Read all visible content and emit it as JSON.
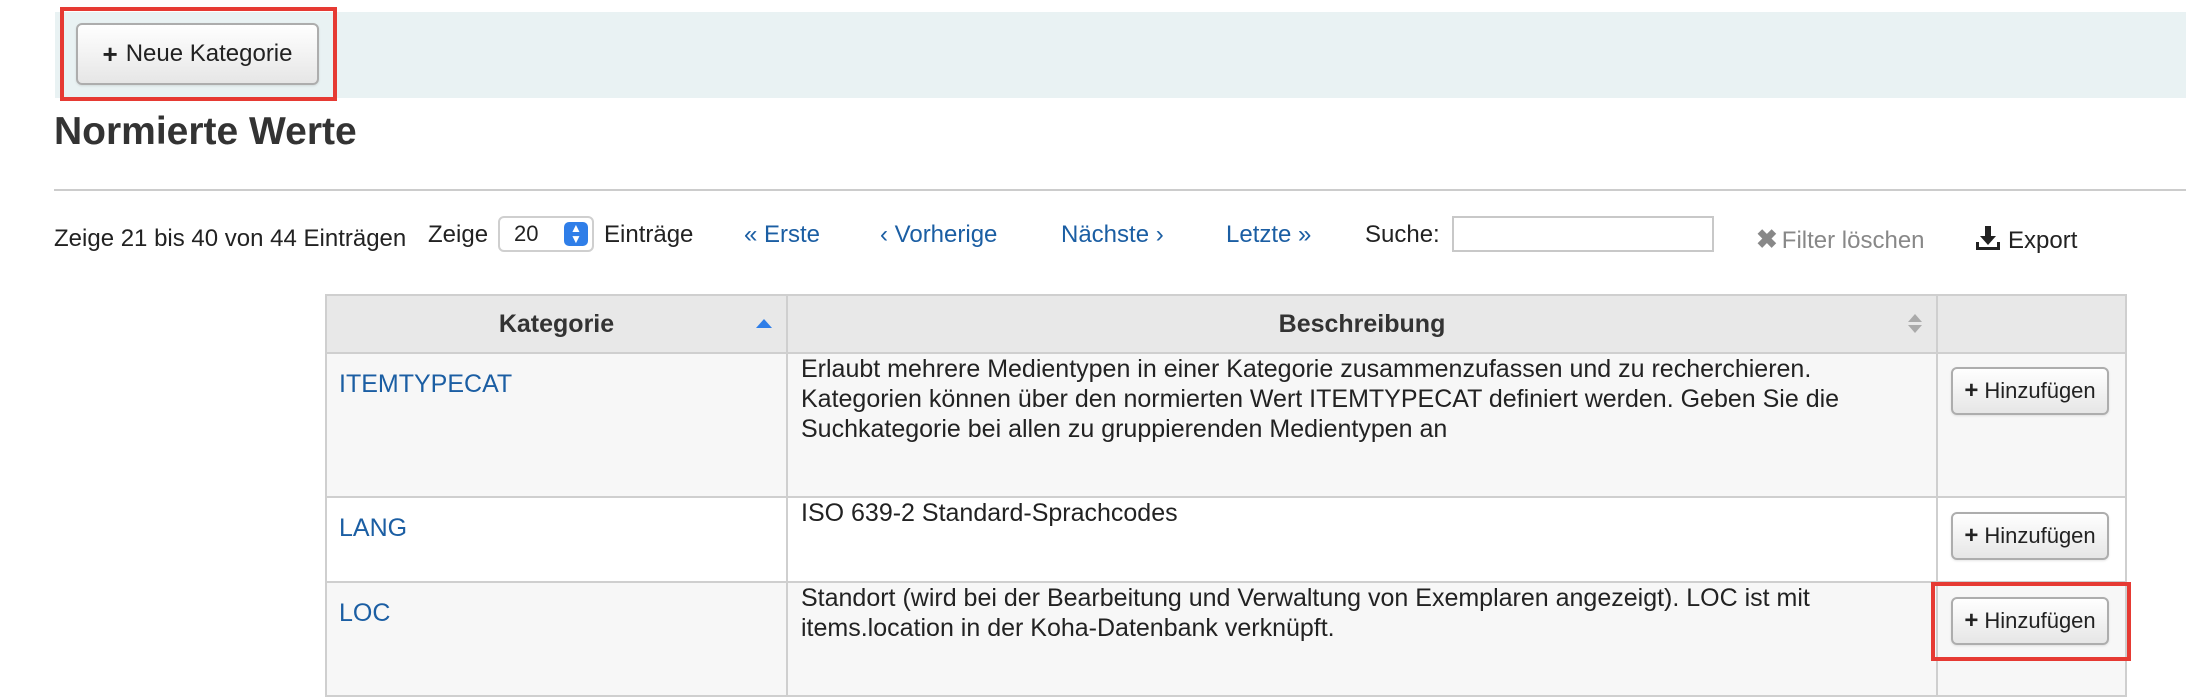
{
  "toolbar": {
    "new_category_label": "Neue Kategorie"
  },
  "page_title": "Normierte Werte",
  "table_controls": {
    "info": "Zeige 21 bis 40 von 44 Einträgen",
    "show_label": "Zeige",
    "page_size": "20",
    "entries_label": "Einträge",
    "first": "« Erste",
    "previous": "‹ Vorherige",
    "next": "Nächste ›",
    "last": "Letzte »",
    "search_label": "Suche:",
    "search_value": "",
    "clear_filter": "Filter löschen",
    "export": "Export"
  },
  "table": {
    "columns": [
      "Kategorie",
      "Beschreibung",
      ""
    ],
    "sorted_column": "Kategorie",
    "rows": [
      {
        "category": "ITEMTYPECAT",
        "description": "Erlaubt mehrere Medientypen in einer Kategorie zusammenzufassen und zu recherchieren. Kategorien können über den normierten Wert ITEMTYPECAT definiert werden. Geben Sie die Suchkategorie bei allen zu gruppierenden Medientypen an",
        "action": "Hinzufügen"
      },
      {
        "category": "LANG",
        "description": "ISO 639-2 Standard-Sprachcodes",
        "action": "Hinzufügen"
      },
      {
        "category": "LOC",
        "description": "Standort (wird bei der Bearbeitung und Verwaltung von Exemplaren angezeigt). LOC ist mit items.location in der Koha-Datenbank verknüpft.",
        "action": "Hinzufügen"
      }
    ]
  },
  "colors": {
    "link": "#1b5ea3",
    "toolbar_bg": "#e9f2f3",
    "highlight": "#e63a33",
    "accent": "#2f7ee8"
  },
  "icons": [
    "plus-icon",
    "chevron-up-down-icon",
    "close-icon",
    "download-icon",
    "sort-asc-icon",
    "sort-both-icon"
  ]
}
